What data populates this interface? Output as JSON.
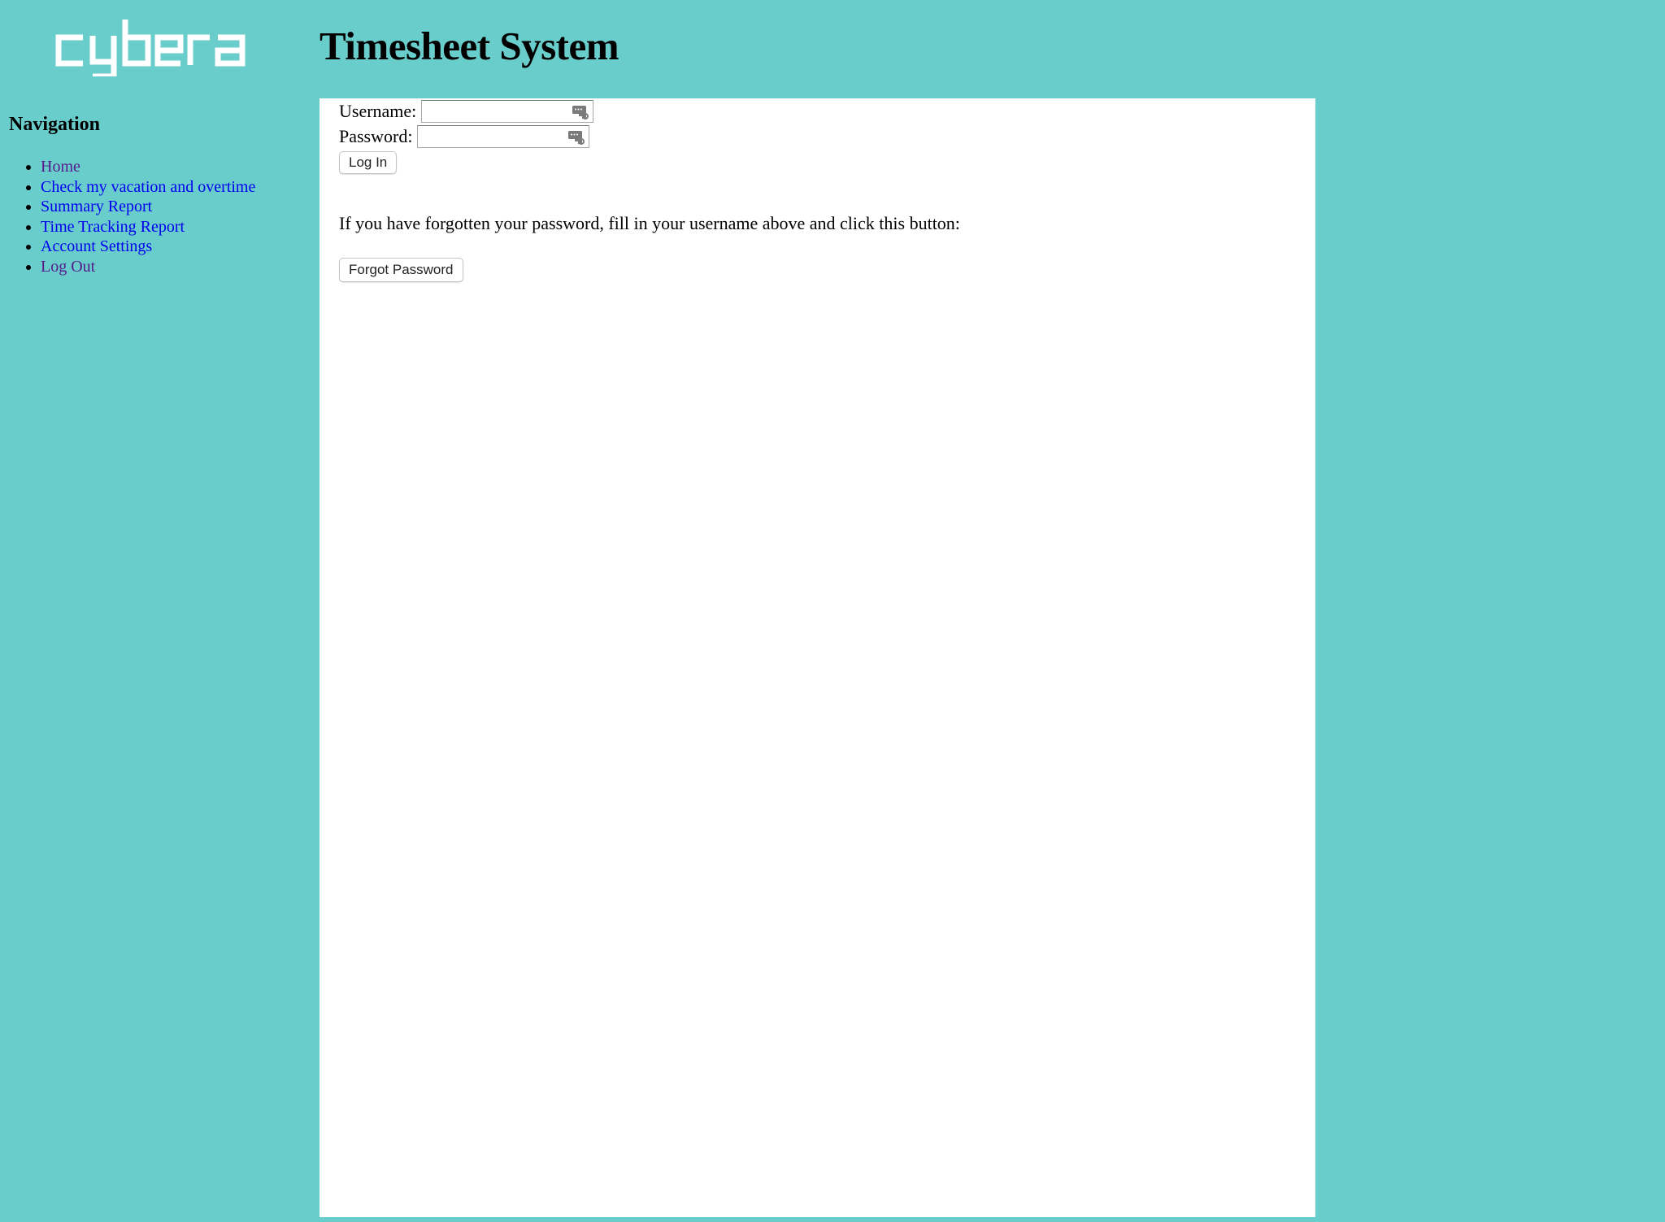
{
  "brand": {
    "logo_text": "cybera",
    "logo_color": "#ffffff"
  },
  "header": {
    "title": "Timesheet System"
  },
  "theme": {
    "background": "#68cdcb",
    "panel": "#ffffff",
    "link": "#0000ee",
    "visited_link": "#551a8b"
  },
  "sidebar": {
    "heading": "Navigation",
    "items": [
      {
        "label": "Home",
        "visited": true
      },
      {
        "label": "Check my vacation and overtime",
        "visited": false
      },
      {
        "label": "Summary Report",
        "visited": false
      },
      {
        "label": "Time Tracking Report",
        "visited": false
      },
      {
        "label": "Account Settings",
        "visited": false
      },
      {
        "label": "Log Out",
        "visited": true
      }
    ]
  },
  "login": {
    "username_label": "Username:",
    "username_value": "",
    "password_label": "Password:",
    "password_value": "",
    "field_icon": "password-manager-key-icon",
    "login_button": "Log In"
  },
  "forgot": {
    "text": "If you have forgotten your password, fill in your username above and click this button:",
    "button": "Forgot Password"
  }
}
